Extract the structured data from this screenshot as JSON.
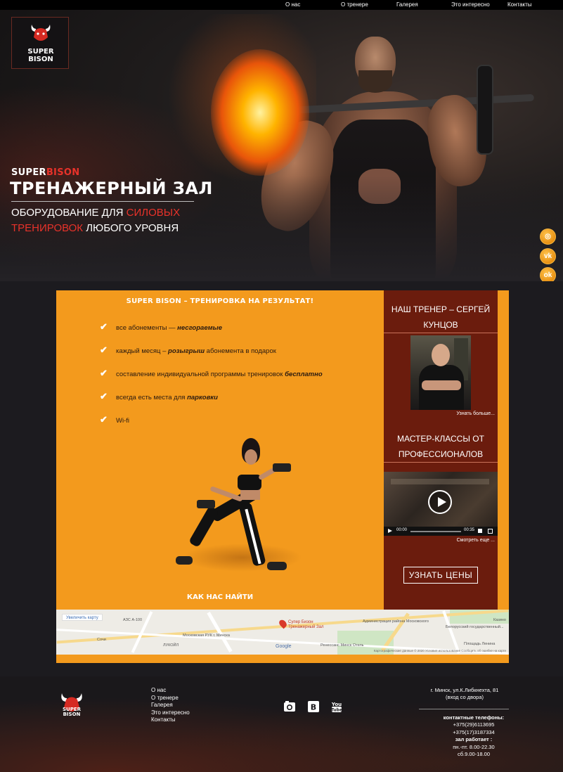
{
  "nav": {
    "items": [
      "О нас",
      "О тренере",
      "Галерея",
      "Это интересно",
      "Контакты"
    ]
  },
  "logo": {
    "line1": "SUPER",
    "line2": "BISON"
  },
  "hero": {
    "brand_white": "SUPER",
    "brand_red": "BISON",
    "title": "ТРЕНАЖЕРНЫЙ ЗАЛ",
    "sub_part1": "ОБОРУДОВАНИЕ ДЛЯ ",
    "sub_red1": "СИЛОВЫХ",
    "sub_red2": "ТРЕНИРОВОК",
    "sub_part2": " ЛЮБОГО УРОВНЯ"
  },
  "social": [
    {
      "icon": "instagram-icon",
      "glyph": "◎"
    },
    {
      "icon": "vk-icon",
      "glyph": "vk"
    },
    {
      "icon": "odnoklassniki-icon",
      "glyph": "ok"
    }
  ],
  "main": {
    "heading": "SUPER BISON – ТРЕНИРОВКА НА РЕЗУЛЬТАТ!",
    "features": [
      {
        "text": "все абонементы — ",
        "bold": "несгораемые",
        "after": ""
      },
      {
        "text": "каждый месяц – ",
        "bold": "розыгрыш",
        "after": " абонемента в подарок"
      },
      {
        "text": "составление индивидуальной программы тренировок ",
        "bold": "бесплатно",
        "after": ""
      },
      {
        "text": "всегда есть места для ",
        "bold": "парковки",
        "after": ""
      },
      {
        "text": "Wi-fi",
        "bold": "",
        "after": ""
      }
    ],
    "find_us": "КАК НАС НАЙТИ"
  },
  "sidebar": {
    "trainer_title_1": "НАШ ТРЕНЕР – СЕРГЕЙ",
    "trainer_title_2": "КУНЦОВ",
    "trainer_more": "Узнать больше...",
    "master_title_1": "МАСТЕР-КЛАССЫ ОТ",
    "master_title_2": "ПРОФЕССИОНАЛОВ",
    "video_time_current": "00:00",
    "video_time_total": "00:35",
    "video_more": "Смотреть еще ...",
    "price_button": "УЗНАТЬ ЦЕНЫ"
  },
  "map": {
    "enlarge": "Увеличить карту",
    "pin_label_1": "Супер Бизон",
    "pin_label_2": "Тренажерный Зал",
    "labels": [
      "АЗС А-100",
      "Московская РУК г. Минска",
      "ЛУКОЙЛ",
      "Сочи",
      "Администрация района Московского",
      "Белорусский государственный...",
      "Ренессанс Минск Отель",
      "Площадь Ленина",
      "Казино"
    ],
    "google": "Google",
    "attribution": "Картографические данные © 2020   Условия использования   Сообщить об ошибке на карте"
  },
  "footer": {
    "logo_line1": "SUPER",
    "logo_line2": "BISON",
    "links": [
      "О нас",
      "О тренере",
      "Галерея",
      "Это интересно",
      "Контакты"
    ],
    "icons": [
      "instagram-icon",
      "vk-icon",
      "youtube-icon"
    ],
    "address_1": "г. Минск, ул.К.Либкнехта, 81",
    "address_2": "(вход со двора)",
    "phones_label": "контактные телефоны:",
    "phone_1": "+375(29)6113695",
    "phone_2": "+375(17)3187334",
    "hours_label": "зал работает :",
    "hours_1": "пн.-пт. 8.00-22.30",
    "hours_2": "сб.9.00-18.00"
  },
  "colors": {
    "accent_orange": "#f39a1d",
    "sidebar_red": "#6b1c0d",
    "brand_red": "#e8322a"
  }
}
